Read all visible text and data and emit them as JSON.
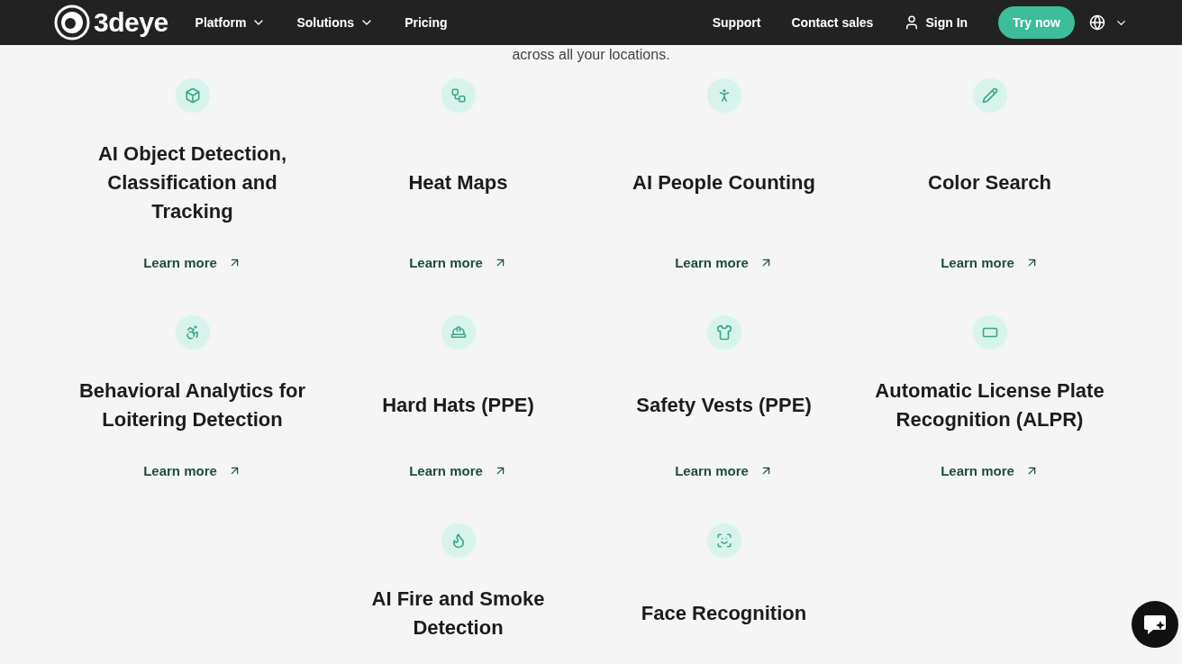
{
  "nav": {
    "logo": "3deye",
    "menu": [
      {
        "label": "Platform",
        "dropdown": true
      },
      {
        "label": "Solutions",
        "dropdown": true
      },
      {
        "label": "Pricing",
        "dropdown": false
      }
    ],
    "right": [
      {
        "label": "Support",
        "kind": "link"
      },
      {
        "label": "Contact sales",
        "kind": "link"
      },
      {
        "label": "Sign In",
        "kind": "signin"
      },
      {
        "label": "Try now",
        "kind": "cta"
      }
    ]
  },
  "intro": "across all your locations.",
  "features": [
    [
      {
        "title": "AI Object Detection, Classification and Tracking",
        "link": "Learn more"
      },
      {
        "title": "Heat Maps",
        "link": "Learn more"
      },
      {
        "title": "AI People Counting",
        "link": "Learn more"
      },
      {
        "title": "Color Search",
        "link": "Learn more"
      }
    ],
    [
      {
        "title": "Behavioral Analytics for Loitering Detection",
        "link": "Learn more"
      },
      {
        "title": "Hard Hats (PPE)",
        "link": "Learn more"
      },
      {
        "title": "Safety Vests (PPE)",
        "link": "Learn more"
      },
      {
        "title": "Automatic License Plate Recognition (ALPR)",
        "link": "Learn more"
      }
    ],
    [
      {
        "title": "AI Fire and Smoke Detection"
      },
      {
        "title": "Face Recognition"
      }
    ]
  ]
}
